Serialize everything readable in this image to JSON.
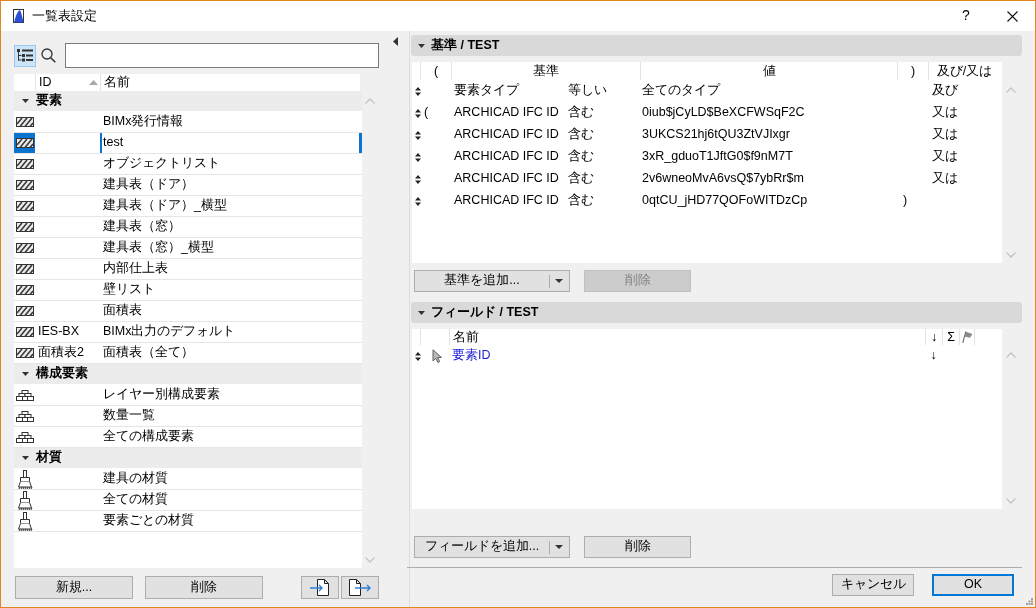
{
  "window": {
    "title": "一覧表設定",
    "help": "?"
  },
  "schedule_list": {
    "tree_view": {
      "on": true
    },
    "columns": [
      {
        "label": "ID",
        "sorted": true
      },
      {
        "label": "名前",
        "sorted": false
      }
    ],
    "groups": [
      {
        "label": "要素",
        "kind": "element",
        "expanded": true,
        "items": [
          {
            "name": "BIMx発行情報",
            "selected": false
          },
          {
            "name": "test",
            "selected": true
          },
          {
            "name": "オブジェクトリスト",
            "selected": false
          },
          {
            "name": "建具表（ドア）",
            "selected": false
          },
          {
            "name": "建具表（ドア）_横型",
            "selected": false
          },
          {
            "name": "建具表（窓）",
            "selected": false
          },
          {
            "name": "建具表（窓）_横型",
            "selected": false
          },
          {
            "name": "内部仕上表",
            "selected": false
          },
          {
            "name": "壁リスト",
            "selected": false
          },
          {
            "name": "面積表",
            "selected": false
          },
          {
            "id": "IES-BX",
            "name": "BIMx出力のデフォルト",
            "selected": false
          },
          {
            "id": "面積表2",
            "name": "面積表（全て）",
            "selected": false
          }
        ]
      },
      {
        "label": "構成要素",
        "kind": "component",
        "expanded": true,
        "items": [
          {
            "name": "レイヤー別構成要素",
            "selected": false
          },
          {
            "name": "数量一覧",
            "selected": false
          },
          {
            "name": "全ての構成要素",
            "selected": false
          }
        ]
      },
      {
        "label": "材質",
        "kind": "material",
        "expanded": true,
        "items": [
          {
            "name": "建具の材質",
            "selected": false
          },
          {
            "name": "全ての材質",
            "selected": false
          },
          {
            "name": "要素ごとの材質",
            "selected": false
          }
        ]
      }
    ]
  },
  "list_buttons": [
    "新規...",
    "削除"
  ],
  "criteria": {
    "title": "基準 / TEST",
    "expanded": true,
    "columns": [
      "(",
      "基準",
      "値",
      ")",
      "及び/又は"
    ],
    "rows": [
      {
        "criterion": "要素タイプ",
        "operator": "等しい",
        "value": "全てのタイプ",
        "logic": "及び"
      },
      {
        "open_paren": "(",
        "criterion": "ARCHICAD IFC ID",
        "operator": "含む",
        "value": "0iub$jCyLD$BeXCFWSqF2C",
        "logic": "又は"
      },
      {
        "criterion": "ARCHICAD IFC ID",
        "operator": "含む",
        "value": "3UKCS21hj6tQU3ZtVJIxgr",
        "logic": "又は"
      },
      {
        "criterion": "ARCHICAD IFC ID",
        "operator": "含む",
        "value": "3xR_gduoT1JftG0$f9nM7T",
        "logic": "又は"
      },
      {
        "criterion": "ARCHICAD IFC ID",
        "operator": "含む",
        "value": "2v6wneoMvA6vsQ$7ybRr$m",
        "logic": "又は"
      },
      {
        "criterion": "ARCHICAD IFC ID",
        "operator": "含む",
        "value": "0qtCU_jHD77QOFoWITDzCp",
        "close_paren": ")"
      }
    ],
    "add_button": "基準を追加...",
    "delete_button": {
      "label": "削除",
      "disabled": true
    }
  },
  "fields": {
    "title": "フィールド / TEST",
    "expanded": true,
    "columns": [
      "名前",
      "↓",
      "Σ"
    ],
    "rows": [
      {
        "name": "要素ID",
        "sort": "↓"
      }
    ],
    "add_button": "フィールドを追加...",
    "delete_button": {
      "label": "削除",
      "disabled": false
    }
  },
  "dialog_buttons": [
    {
      "label": "キャンセル",
      "default": false
    },
    {
      "label": "OK",
      "default": true
    }
  ]
}
